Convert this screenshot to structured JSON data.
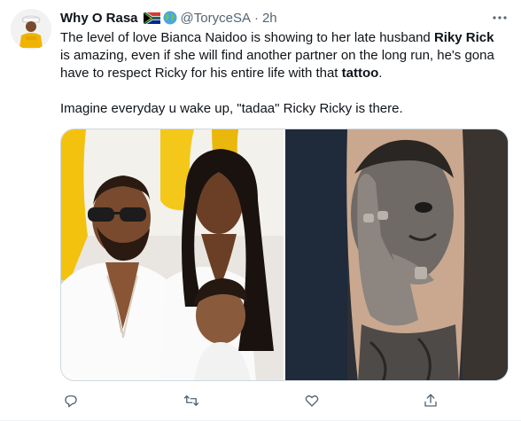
{
  "tweet": {
    "author_name": "Why O Rasa",
    "author_handle": "@ToryceSA",
    "separator": "·",
    "timestamp": "2h",
    "text_segments": [
      "The level of love Bianca Naidoo is showing to her late husband ",
      "Riky Rick",
      " is amazing, even if she will find another partner on the long run, he's gona have to respect Ricky for his entire life with that ",
      "tattoo",
      "."
    ],
    "text_line2": "Imagine everyday u wake up, \"tadaa\" Ricky Ricky is there.",
    "icons": {
      "flag": "south-africa-flag-icon",
      "globe": "globe-emoji-icon",
      "more": "more-options-icon",
      "reply": "reply-icon",
      "retweet": "retweet-icon",
      "like": "like-icon",
      "share": "share-icon"
    },
    "colors": {
      "text": "#0f1419",
      "secondary": "#536471",
      "border": "#cfd9de"
    }
  }
}
